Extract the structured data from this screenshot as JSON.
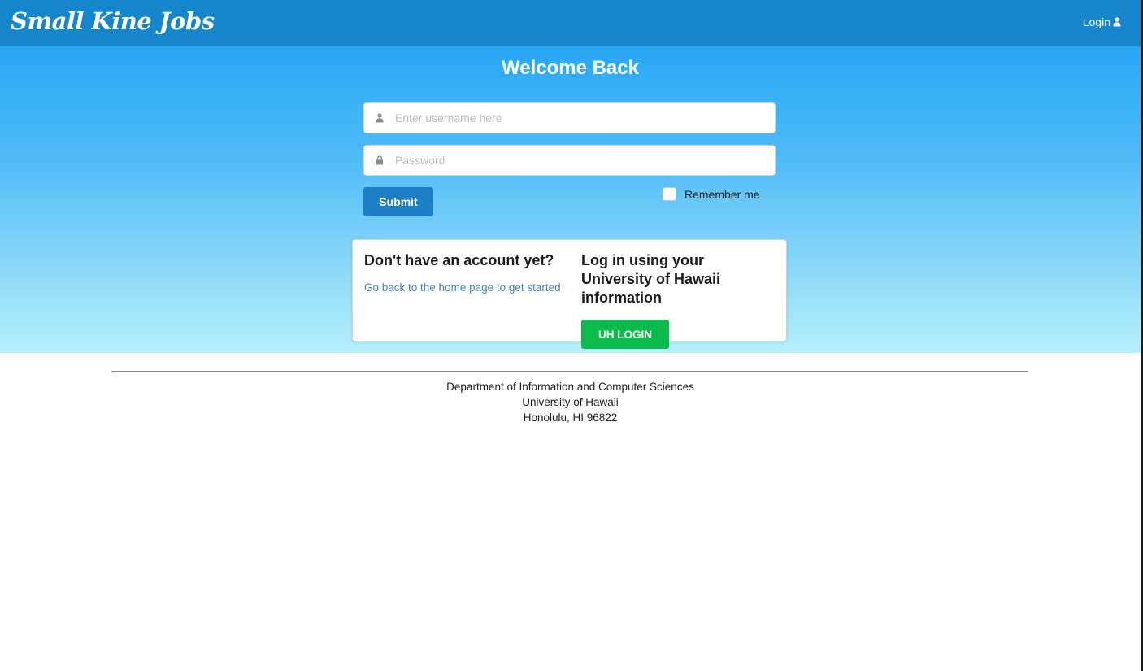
{
  "navbar": {
    "brand": "Small Kine Jobs",
    "login_label": "Login"
  },
  "hero": {
    "title": "Welcome Back"
  },
  "form": {
    "username_placeholder": "Enter username here",
    "password_placeholder": "Password",
    "submit_label": "Submit",
    "remember_label": "Remember me",
    "remember_checked": false
  },
  "card": {
    "left_heading": "Don't have an account yet?",
    "left_link": "Go back to the home page to get started",
    "right_heading": "Log in using your University of Hawaii information",
    "uh_login_label": "UH LOGIN"
  },
  "footer": {
    "line1": "Department of Information and Computer Sciences",
    "line2": "University of Hawaii",
    "line3": "Honolulu, HI 96822"
  },
  "icons": {
    "user": "user-icon",
    "lock": "lock-icon"
  },
  "colors": {
    "navbar": "#1585cc",
    "submit": "#1d80c6",
    "uh_login": "#0cba4b",
    "link": "#4183c4"
  }
}
